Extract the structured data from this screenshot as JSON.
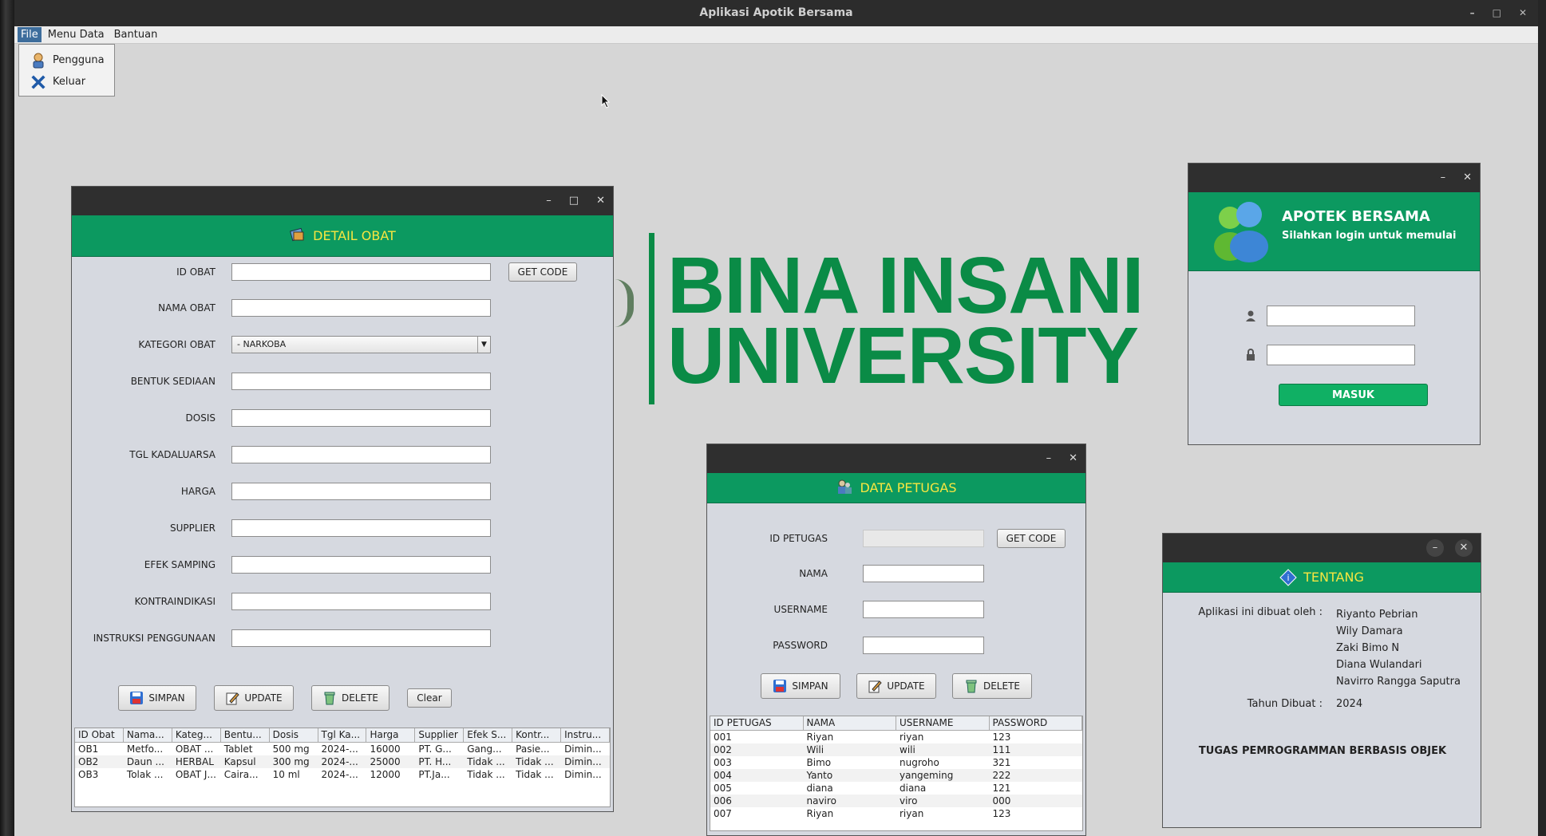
{
  "window": {
    "title": "Aplikasi Apotik Bersama"
  },
  "menubar": {
    "items": [
      "File",
      "Menu Data",
      "Bantuan"
    ]
  },
  "file_menu": {
    "items": [
      {
        "label": "Pengguna",
        "icon": "user-icon"
      },
      {
        "label": "Keluar",
        "icon": "close-x-icon"
      }
    ]
  },
  "background": {
    "line1": "BINA INSANI",
    "line2": "UNIVERSITY"
  },
  "detail_obat": {
    "title": "DETAIL OBAT",
    "labels": {
      "id": "ID OBAT",
      "nama": "NAMA OBAT",
      "kategori": "KATEGORI OBAT",
      "bentuk": "BENTUK SEDIAAN",
      "dosis": "DOSIS",
      "tgl": "TGL KADALUARSA",
      "harga": "HARGA",
      "supplier": "SUPPLIER",
      "efek": "EFEK SAMPING",
      "kontra": "KONTRAINDIKASI",
      "instruksi": "INSTRUKSI PENGGUNAAN"
    },
    "kategori_selected": "- NARKOBA",
    "get_code": "GET CODE",
    "buttons": {
      "simpan": "SIMPAN",
      "update": "UPDATE",
      "delete": "DELETE",
      "clear": "Clear"
    },
    "table": {
      "headers": [
        "ID Obat",
        "Nama...",
        "Kateg...",
        "Bentu...",
        "Dosis",
        "Tgl Ka...",
        "Harga",
        "Supplier",
        "Efek S...",
        "Kontr...",
        "Instru..."
      ],
      "rows": [
        [
          "OB1",
          "Metfo...",
          "OBAT ...",
          "Tablet",
          "500 mg",
          "2024-...",
          "16000",
          "PT. G...",
          "Gang...",
          "Pasie...",
          "Dimin..."
        ],
        [
          "OB2",
          "Daun ...",
          "HERBAL",
          "Kapsul",
          "300 mg",
          "2024-...",
          "25000",
          "PT. H...",
          "Tidak ...",
          "Tidak ...",
          "Dimin..."
        ],
        [
          "OB3",
          "Tolak ...",
          "OBAT J...",
          "Caira...",
          "10 ml",
          "2024-...",
          "12000",
          "PT.Ja...",
          "Tidak ...",
          "Tidak ...",
          "Dimin..."
        ]
      ]
    }
  },
  "data_petugas": {
    "title": "DATA PETUGAS",
    "labels": {
      "id": "ID PETUGAS",
      "nama": "NAMA",
      "username": "USERNAME",
      "password": "PASSWORD"
    },
    "get_code": "GET CODE",
    "buttons": {
      "simpan": "SIMPAN",
      "update": "UPDATE",
      "delete": "DELETE"
    },
    "table": {
      "headers": [
        "ID PETUGAS",
        "NAMA",
        "USERNAME",
        "PASSWORD"
      ],
      "rows": [
        [
          "001",
          "Riyan",
          "riyan",
          "123"
        ],
        [
          "002",
          "Wili",
          "wili",
          "111"
        ],
        [
          "003",
          "Bimo",
          "nugroho",
          "321"
        ],
        [
          "004",
          "Yanto",
          "yangeming",
          "222"
        ],
        [
          "005",
          "diana",
          "diana",
          "121"
        ],
        [
          "006",
          "naviro",
          "viro",
          "000"
        ],
        [
          "007",
          "Riyan",
          "riyan",
          "123"
        ]
      ]
    }
  },
  "login": {
    "title": "APOTEK BERSAMA",
    "subtitle": "Silahkan login untuk memulai",
    "button": "MASUK"
  },
  "tentang": {
    "title": "TENTANG",
    "made_by_label": "Aplikasi ini dibuat oleh :",
    "authors": [
      "Riyanto Pebrian",
      "Wily Damara",
      "Zaki Bimo N",
      "Diana Wulandari",
      "Navirro Rangga Saputra"
    ],
    "year_label": "Tahun Dibuat :",
    "year": "2024",
    "footer": "TUGAS PEMROGRAMMAN BERBASIS OBJEK"
  },
  "colors": {
    "header_green": "#0c9960",
    "title_yellow": "#f7e640",
    "brand_green": "#0a8b46"
  }
}
